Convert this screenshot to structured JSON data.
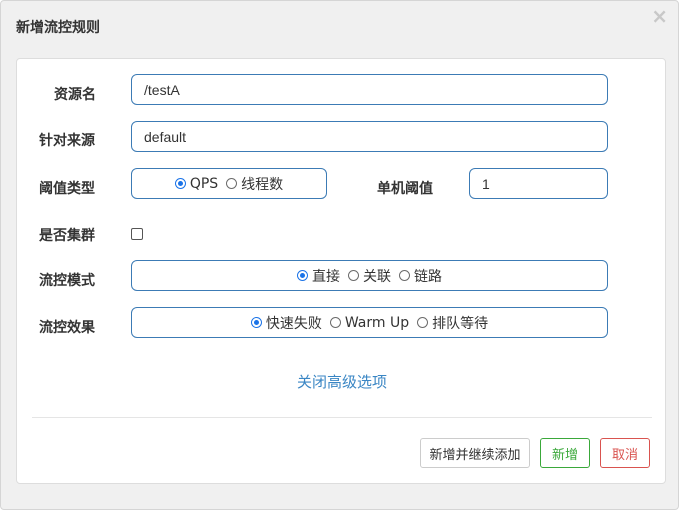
{
  "dialog": {
    "title": "新增流控规则",
    "close_icon": "×"
  },
  "form": {
    "resource_name": {
      "label": "资源名",
      "value": "/testA"
    },
    "limit_app": {
      "label": "针对来源",
      "value": "default"
    },
    "threshold_type": {
      "label": "阈值类型",
      "options": [
        "QPS",
        "线程数"
      ],
      "selected": "QPS"
    },
    "single_threshold": {
      "label": "单机阈值",
      "value": "1"
    },
    "cluster": {
      "label": "是否集群",
      "checked": false
    },
    "flow_mode": {
      "label": "流控模式",
      "options": [
        "直接",
        "关联",
        "链路"
      ],
      "selected": "直接"
    },
    "flow_effect": {
      "label": "流控效果",
      "options": [
        "快速失败",
        "Warm Up",
        "排队等待"
      ],
      "selected": "快速失败"
    },
    "advanced_toggle": "关闭高级选项"
  },
  "buttons": {
    "add_continue": "新增并继续添加",
    "add": "新增",
    "cancel": "取消"
  },
  "colors": {
    "input_border": "#3c7bb5",
    "link": "#3a86c4",
    "success": "#3aa83a",
    "danger": "#d9534f",
    "radio_checked": "#1a73e8"
  }
}
